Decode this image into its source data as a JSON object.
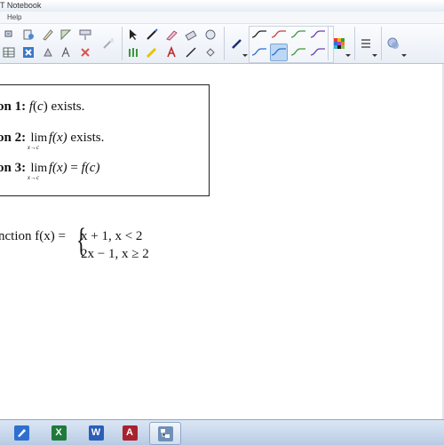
{
  "window": {
    "title": "T Notebook"
  },
  "menu": {
    "help_label": "Help"
  },
  "toolbar": {
    "groups": [
      "page-tools",
      "pen-tools",
      "line-styles",
      "color-palette",
      "properties"
    ]
  },
  "content": {
    "condition1": {
      "label": "on 1:",
      "text": "exists.",
      "expr_f": "f",
      "expr_c": "c"
    },
    "condition2": {
      "label": "on 2:",
      "lim": "lim",
      "sub": "x→c",
      "expr": "f(x)",
      "text": "exists."
    },
    "condition3": {
      "label": "on 3:",
      "lim": "lim",
      "sub": "x→c",
      "expr": "f(x)",
      "equals": "=",
      "rhs": "f(c)"
    },
    "piecewise": {
      "prefix": "nction f(x) =",
      "case1": "x + 1,  x < 2",
      "case2": "2x − 1,  x ≥ 2"
    }
  },
  "taskbar": {
    "apps": [
      "notebook-app",
      "excel-app",
      "word-app",
      "access-app",
      "network-app"
    ],
    "word_letter": "W",
    "excel_letter": "X",
    "access_letter": "A"
  },
  "colors": {
    "accent": "#3b7fd1",
    "toolbar_bg": "#eef2f8",
    "taskbar_bg": "#c6d6ec"
  }
}
